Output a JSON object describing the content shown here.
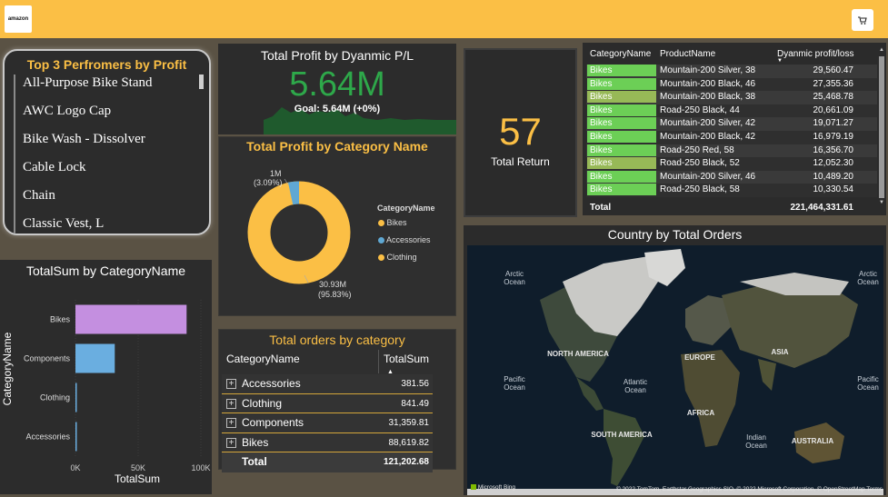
{
  "header": {
    "logo_text": "amazon",
    "cart_icon": "cart-icon"
  },
  "performers": {
    "title": "Top 3 Perfromers by Profit",
    "items": [
      "All-Purpose Bike Stand",
      "AWC Logo Cap",
      "Bike Wash - Dissolver",
      "Cable Lock",
      "Chain",
      "Classic Vest, L"
    ]
  },
  "pl_card": {
    "title": "Total Profit by Dyanmic P/L",
    "value": "5.64M",
    "goal": "Goal: 5.64M (+0%)",
    "value_color": "#2ea84a"
  },
  "donut": {
    "title": "Total Profit by Category Name",
    "legend_title": "CategoryName",
    "small_label": "1M",
    "small_pct": "(3.09%)",
    "big_label": "30.93M",
    "big_pct": "(95.83%)",
    "legend": [
      {
        "name": "Bikes",
        "color": "#fbbf45"
      },
      {
        "name": "Accessories",
        "color": "#5fa8d3"
      },
      {
        "name": "Clothing",
        "color": "#fbbf45"
      }
    ]
  },
  "orders": {
    "title": "Total orders by category",
    "col1": "CategoryName",
    "col2": "TotalSum",
    "rows": [
      {
        "name": "Accessories",
        "value": "381.56"
      },
      {
        "name": "Clothing",
        "value": "841.49"
      },
      {
        "name": "Components",
        "value": "31,359.81"
      },
      {
        "name": "Bikes",
        "value": "88,619.82"
      }
    ],
    "total_label": "Total",
    "total_value": "121,202.68"
  },
  "chart_data": {
    "type": "bar",
    "orientation": "horizontal",
    "title": "TotalSum by CategoryName",
    "xlabel": "TotalSum",
    "ylabel": "CategoryName",
    "categories": [
      "Bikes",
      "Components",
      "Clothing",
      "Accessories"
    ],
    "values": [
      88619.82,
      31359.81,
      841.49,
      381.56
    ],
    "colors": [
      "#c48fe0",
      "#6aaee0",
      "#6aaee0",
      "#6aaee0"
    ],
    "xlim": [
      0,
      100000
    ],
    "xticks": [
      "0K",
      "50K",
      "100K"
    ],
    "grid": true,
    "legend": "none"
  },
  "return_card": {
    "value": "57",
    "label": "Total Return"
  },
  "products": {
    "col_cat": "CategoryName",
    "col_prod": "ProductName",
    "col_val": "Dyanmic profit/loss",
    "rows": [
      {
        "cat": "Bikes",
        "prod": "Mountain-200 Silver, 38",
        "val": "29,560.47",
        "color": "#6ccf56"
      },
      {
        "cat": "Bikes",
        "prod": "Mountain-200 Black, 46",
        "val": "27,355.36",
        "color": "#6ccf56"
      },
      {
        "cat": "Bikes",
        "prod": "Mountain-200 Black, 38",
        "val": "25,468.78",
        "color": "#97b957"
      },
      {
        "cat": "Bikes",
        "prod": "Road-250 Black, 44",
        "val": "20,661.09",
        "color": "#6ccf56"
      },
      {
        "cat": "Bikes",
        "prod": "Mountain-200 Silver, 42",
        "val": "19,071.27",
        "color": "#6ccf56"
      },
      {
        "cat": "Bikes",
        "prod": "Mountain-200 Black, 42",
        "val": "16,979.19",
        "color": "#6ccf56"
      },
      {
        "cat": "Bikes",
        "prod": "Road-250 Red, 58",
        "val": "16,356.70",
        "color": "#6ccf56"
      },
      {
        "cat": "Bikes",
        "prod": "Road-250 Black, 52",
        "val": "12,052.30",
        "color": "#97b957"
      },
      {
        "cat": "Bikes",
        "prod": "Mountain-200 Silver, 46",
        "val": "10,489.20",
        "color": "#6ccf56"
      },
      {
        "cat": "Bikes",
        "prod": "Road-250 Black, 58",
        "val": "10,330.54",
        "color": "#6ccf56"
      }
    ],
    "total_label": "Total",
    "total_value": "221,464,331.61"
  },
  "map": {
    "title": "Country by Total Orders",
    "labels": [
      "Arctic Ocean",
      "Arctic Ocean",
      "NORTH AMERICA",
      "EUROPE",
      "ASIA",
      "Pacific Ocean",
      "Atlantic Ocean",
      "Indian Ocean",
      "Pacific Ocean",
      "AFRICA",
      "SOUTH AMERICA",
      "AUSTRALIA"
    ],
    "bing": "Microsoft Bing",
    "copyright": "© 2022 TomTom, Earthstar Geographics SIO, © 2022 Microsoft Corporation, © OpenStreetMap Terms"
  }
}
